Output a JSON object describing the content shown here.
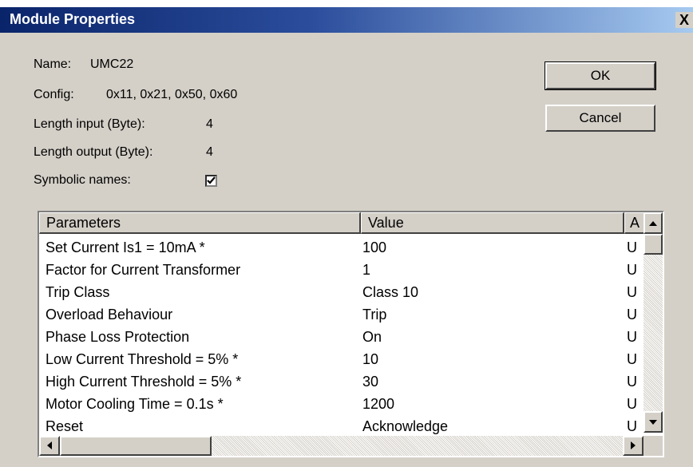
{
  "window": {
    "title": "Module Properties",
    "close_glyph": "X"
  },
  "info": {
    "name_label": "Name:",
    "name_value": "UMC22",
    "config_label": "Config:",
    "config_value": "0x11, 0x21, 0x50, 0x60",
    "length_input_label": "Length input (Byte):",
    "length_input_value": "4",
    "length_output_label": "Length output (Byte):",
    "length_output_value": "4",
    "symbolic_names_label": "Symbolic names:",
    "symbolic_names_checked": true
  },
  "buttons": {
    "ok": "OK",
    "cancel": "Cancel"
  },
  "table": {
    "columns": [
      "Parameters",
      "Value",
      "A"
    ],
    "rows": [
      [
        "Set Current Is1 = 10mA *",
        "100",
        "U"
      ],
      [
        "Factor for Current Transformer",
        "1",
        "U"
      ],
      [
        "Trip Class",
        "Class 10",
        "U"
      ],
      [
        "Overload Behaviour",
        "Trip",
        "U"
      ],
      [
        "Phase Loss Protection",
        "On",
        "U"
      ],
      [
        "Low Current Threshold = 5% *",
        "10",
        "U"
      ],
      [
        "High Current Threshold = 5% *",
        "30",
        "U"
      ],
      [
        "Motor Cooling Time = 0.1s *",
        "1200",
        "U"
      ],
      [
        "Reset",
        "Acknowledge",
        "U"
      ]
    ]
  },
  "icons": {
    "scroll_up": "triangle-up-icon",
    "scroll_down": "triangle-down-icon",
    "scroll_left": "triangle-left-icon",
    "scroll_right": "triangle-right-icon",
    "check": "checkmark-icon"
  }
}
